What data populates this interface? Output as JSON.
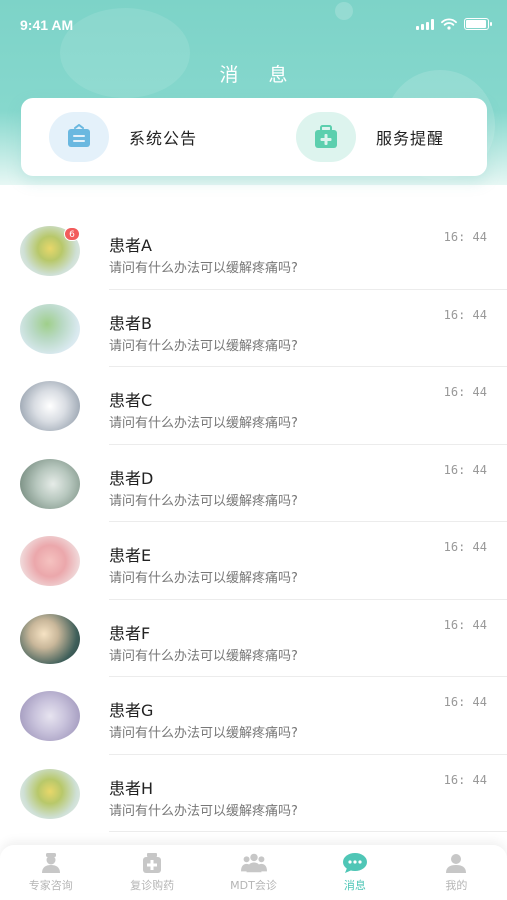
{
  "status_bar": {
    "time": "9:41 AM",
    "battery_level": 0.95
  },
  "header": {
    "title": "消 息"
  },
  "quick_actions": [
    {
      "label": "系统公告",
      "icon": "announcement-icon",
      "color": "#6ab8e0"
    },
    {
      "label": "服务提醒",
      "icon": "medical-kit-icon",
      "color": "#5ccfae"
    }
  ],
  "messages": [
    {
      "name": "患者A",
      "preview": "请问有什么办法可以缓解疼痛吗?",
      "time": "16: 44",
      "badge": "6"
    },
    {
      "name": "患者B",
      "preview": "请问有什么办法可以缓解疼痛吗?",
      "time": "16: 44"
    },
    {
      "name": "患者C",
      "preview": "请问有什么办法可以缓解疼痛吗?",
      "time": "16: 44"
    },
    {
      "name": "患者D",
      "preview": "请问有什么办法可以缓解疼痛吗?",
      "time": "16: 44"
    },
    {
      "name": "患者E",
      "preview": "请问有什么办法可以缓解疼痛吗?",
      "time": "16: 44"
    },
    {
      "name": "患者F",
      "preview": "请问有什么办法可以缓解疼痛吗?",
      "time": "16: 44"
    },
    {
      "name": "患者G",
      "preview": "请问有什么办法可以缓解疼痛吗?",
      "time": "16: 44"
    },
    {
      "name": "患者H",
      "preview": "请问有什么办法可以缓解疼痛吗?",
      "time": "16: 44"
    }
  ],
  "tabbar": {
    "items": [
      {
        "label": "专家咨询",
        "icon": "doctor-icon",
        "active": false
      },
      {
        "label": "复诊购药",
        "icon": "medicine-box-icon",
        "active": false
      },
      {
        "label": "MDT会诊",
        "icon": "group-consult-icon",
        "active": false
      },
      {
        "label": "消息",
        "icon": "chat-bubble-icon",
        "active": true
      },
      {
        "label": "我的",
        "icon": "profile-icon",
        "active": false
      }
    ],
    "active_color": "#4fc6b6",
    "inactive_color": "#b5b5b5"
  }
}
